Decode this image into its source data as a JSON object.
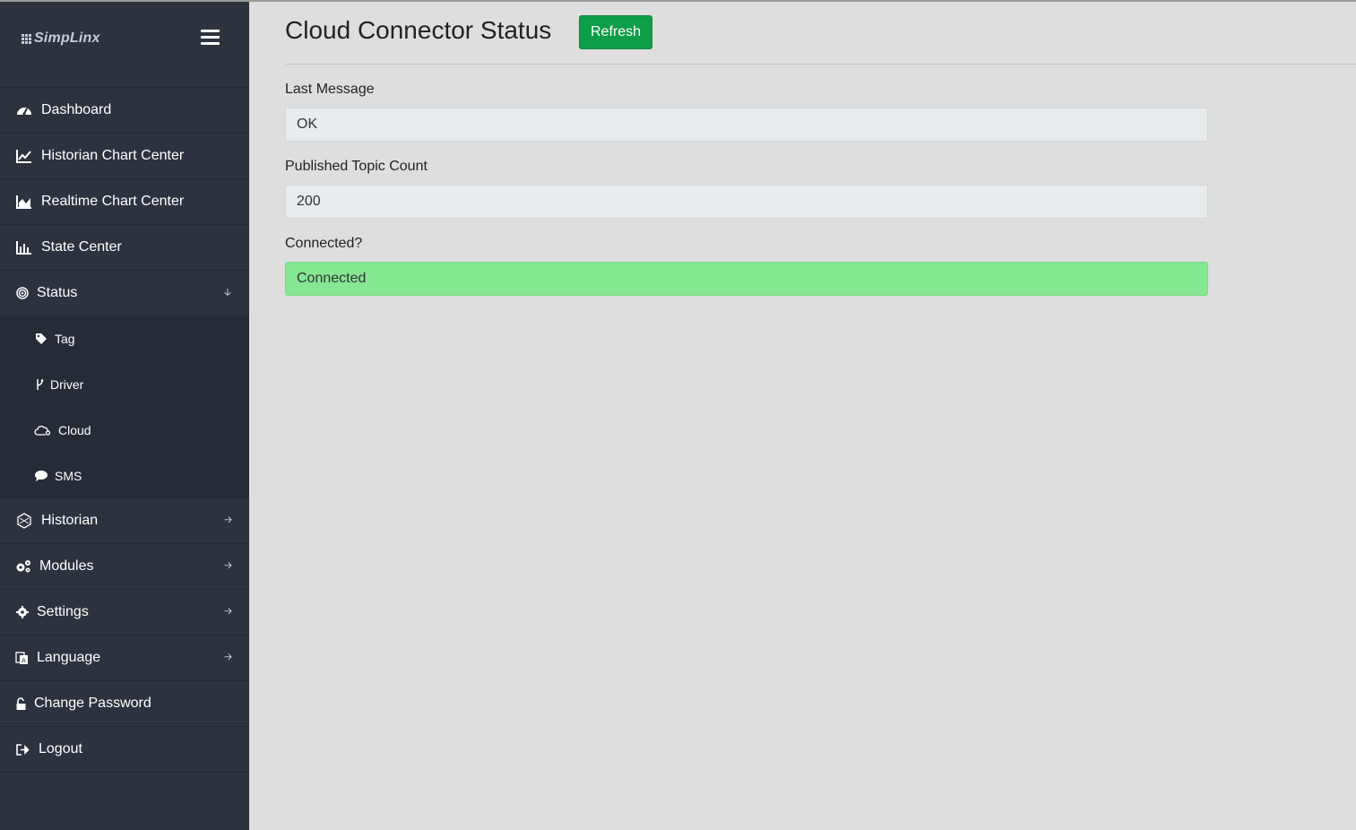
{
  "app": {
    "logo_text": "SimpLinx"
  },
  "sidebar": {
    "items": [
      {
        "label": "Dashboard",
        "icon": "dashboard-icon"
      },
      {
        "label": "Historian Chart Center",
        "icon": "line-chart-icon"
      },
      {
        "label": "Realtime Chart Center",
        "icon": "area-chart-icon"
      },
      {
        "label": "State Center",
        "icon": "bar-chart-icon"
      },
      {
        "label": "Status",
        "icon": "status-icon",
        "expanded": true
      },
      {
        "label": "Historian",
        "icon": "historian-icon"
      },
      {
        "label": "Modules",
        "icon": "cogs-icon"
      },
      {
        "label": "Settings",
        "icon": "gear-icon"
      },
      {
        "label": "Language",
        "icon": "language-icon"
      },
      {
        "label": "Change Password",
        "icon": "unlock-icon"
      },
      {
        "label": "Logout",
        "icon": "logout-icon"
      }
    ],
    "status_submenu": [
      {
        "label": "Tag",
        "icon": "tag-icon"
      },
      {
        "label": "Driver",
        "icon": "branch-icon"
      },
      {
        "label": "Cloud",
        "icon": "cloud-icon"
      },
      {
        "label": "SMS",
        "icon": "chat-icon"
      }
    ]
  },
  "main": {
    "title": "Cloud Connector Status",
    "refresh_label": "Refresh",
    "fields": [
      {
        "label": "Last Message",
        "value": "OK"
      },
      {
        "label": "Published Topic Count",
        "value": "200"
      },
      {
        "label": "Connected?",
        "value": "Connected"
      }
    ]
  },
  "colors": {
    "sidebar_bg": "#2c333e",
    "submenu_bg": "#262c36",
    "refresh_button": "#0e9e47",
    "connected_bg": "#86e793",
    "page_bg": "#dedede"
  }
}
